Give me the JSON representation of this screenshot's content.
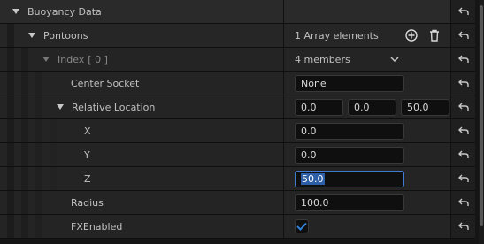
{
  "colors": {
    "accent": "#3f7ad6",
    "row_bg": "#242424",
    "check": "#2f7fd8"
  },
  "rows": {
    "buoyancy_data": {
      "label": "Buoyancy Data"
    },
    "pontoons": {
      "label": "Pontoons",
      "value": "1 Array elements",
      "add_icon": "plus-circle-icon",
      "delete_icon": "trash-icon"
    },
    "index": {
      "label": "Index",
      "index_value": "[ 0 ]",
      "value": "4 members",
      "dropdown_icon": "chevron-down-icon"
    },
    "center_socket": {
      "label": "Center Socket",
      "value": "None"
    },
    "relative_location": {
      "label": "Relative Location",
      "x": "0.0",
      "y": "0.0",
      "z": "50.0"
    },
    "x": {
      "label": "X",
      "value": "0.0"
    },
    "y": {
      "label": "Y",
      "value": "0.0"
    },
    "z": {
      "label": "Z",
      "value": "50.0"
    },
    "radius": {
      "label": "Radius",
      "value": "100.0"
    },
    "fx_enabled": {
      "label": "FXEnabled",
      "checked": true
    }
  },
  "reset_icon": "reset-arrow-icon"
}
